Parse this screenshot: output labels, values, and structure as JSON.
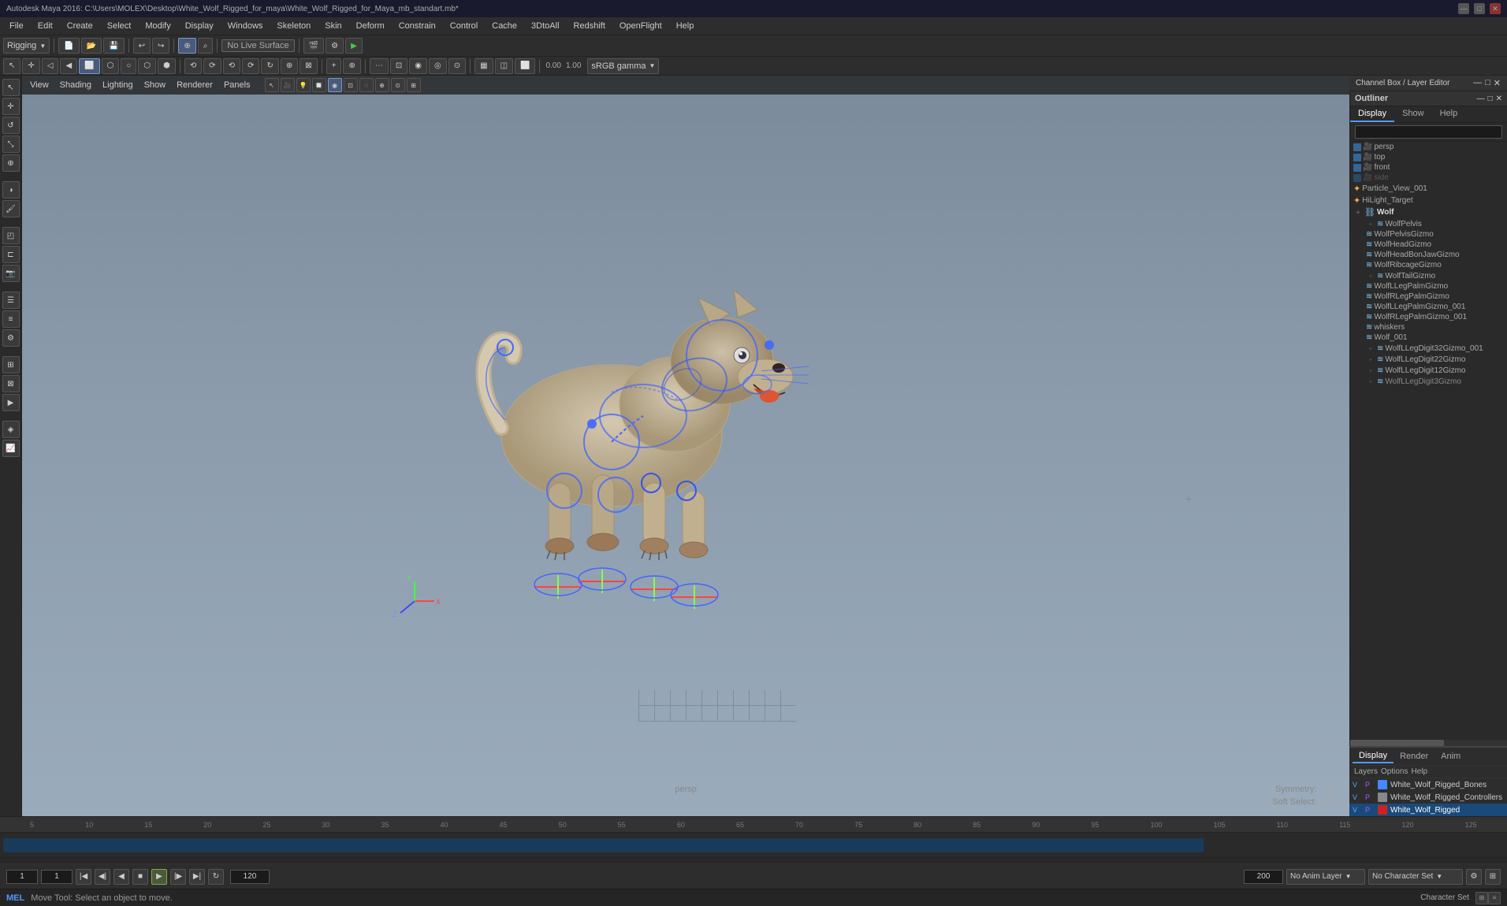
{
  "titlebar": {
    "title": "Autodesk Maya 2016: C:\\Users\\MOLEX\\Desktop\\White_Wolf_Rigged_for_maya\\White_Wolf_Rigged_for_Maya_mb_standart.mb*",
    "minimize": "—",
    "maximize": "□",
    "close": "✕"
  },
  "menubar": {
    "items": [
      "File",
      "Edit",
      "Create",
      "Select",
      "Modify",
      "Display",
      "Windows",
      "Skeleton",
      "Skin",
      "Deform",
      "Constrain",
      "Control",
      "Cache",
      "3DtoAll",
      "Redshift",
      "OpenFlight",
      "Help"
    ]
  },
  "toolbar1": {
    "mode_dropdown": "Rigging",
    "no_live_surface": "No Live Surface"
  },
  "viewport": {
    "menu_items": [
      "View",
      "Shading",
      "Lighting",
      "Show",
      "Renderer",
      "Panels"
    ],
    "persp_label": "persp",
    "symmetry_label": "Symmetry:",
    "symmetry_value": "Off",
    "soft_select_label": "Soft Select:",
    "soft_select_value": "Off",
    "gamma_label": "sRGB gamma",
    "val1": "0.00",
    "val2": "1.00"
  },
  "outliner": {
    "title": "Outliner",
    "tabs": [
      "Display",
      "Show",
      "Help"
    ],
    "items": [
      {
        "indent": 0,
        "icon": "cam",
        "expand": "",
        "label": "persp",
        "color": "#336699"
      },
      {
        "indent": 0,
        "icon": "cam",
        "expand": "",
        "label": "top",
        "color": "#336699"
      },
      {
        "indent": 0,
        "icon": "cam",
        "expand": "",
        "label": "front",
        "color": "#336699"
      },
      {
        "indent": 0,
        "icon": "cam",
        "expand": "",
        "label": "side",
        "color": "#336699"
      },
      {
        "indent": 0,
        "icon": "star",
        "expand": "",
        "label": "Particle_View_001",
        "color": ""
      },
      {
        "indent": 0,
        "icon": "star",
        "expand": "",
        "label": "HiLight_Target",
        "color": ""
      },
      {
        "indent": 0,
        "icon": "chain",
        "expand": "+",
        "label": "Wolf",
        "color": ""
      },
      {
        "indent": 1,
        "icon": "chain",
        "expand": "",
        "label": "WolfPelvis",
        "color": ""
      },
      {
        "indent": 1,
        "icon": "chain",
        "expand": "",
        "label": "WolfPelvisGizmo",
        "color": ""
      },
      {
        "indent": 1,
        "icon": "chain",
        "expand": "",
        "label": "WolfHeadGizmo",
        "color": ""
      },
      {
        "indent": 1,
        "icon": "chain",
        "expand": "",
        "label": "WolfHeadBonJawGizmo",
        "color": ""
      },
      {
        "indent": 1,
        "icon": "chain",
        "expand": "",
        "label": "WolfRibcageGizmo",
        "color": ""
      },
      {
        "indent": 1,
        "icon": "chain",
        "expand": "+",
        "label": "WolfTailGizmo",
        "color": ""
      },
      {
        "indent": 1,
        "icon": "chain",
        "expand": "",
        "label": "WolfLLegPalmGizmo",
        "color": ""
      },
      {
        "indent": 1,
        "icon": "chain",
        "expand": "",
        "label": "WolfRLegPalmGizmo",
        "color": ""
      },
      {
        "indent": 1,
        "icon": "chain",
        "expand": "",
        "label": "WolfLLegPalmGizmo_001",
        "color": ""
      },
      {
        "indent": 1,
        "icon": "chain",
        "expand": "",
        "label": "WolfRLegPalmGizmo_001",
        "color": ""
      },
      {
        "indent": 1,
        "icon": "chain",
        "expand": "",
        "label": "whiskers",
        "color": ""
      },
      {
        "indent": 1,
        "icon": "chain",
        "expand": "",
        "label": "Wolf_001",
        "color": ""
      },
      {
        "indent": 1,
        "icon": "chain",
        "expand": "+",
        "label": "WolfLLegDigit32Gizmo_001",
        "color": ""
      },
      {
        "indent": 1,
        "icon": "chain",
        "expand": "+",
        "label": "WolfLLegDigit22Gizmo",
        "color": ""
      },
      {
        "indent": 1,
        "icon": "chain",
        "expand": "+",
        "label": "WolfLLegDigit12Gizmo",
        "color": ""
      },
      {
        "indent": 1,
        "icon": "chain",
        "expand": "+",
        "label": "WolfLLegDigit3Gizmo",
        "color": ""
      }
    ]
  },
  "layer_panel": {
    "tabs": [
      "Display",
      "Render",
      "Anim"
    ],
    "options": [
      "Layers",
      "Options",
      "Help"
    ],
    "layers": [
      {
        "v": "V",
        "p": "P",
        "color": "#4488ff",
        "name": "White_Wolf_Rigged_Bones",
        "highlighted": false
      },
      {
        "v": "V",
        "p": "P",
        "color": "#888888",
        "name": "White_Wolf_Rigged_Controllers",
        "highlighted": false
      },
      {
        "v": "V",
        "p": "P",
        "color": "#cc2222",
        "name": "White_Wolf_Rigged",
        "highlighted": true
      }
    ]
  },
  "channelbox": {
    "header": "Channel Box / Layer Editor",
    "tabs": [
      "Display",
      "Render",
      "Anim"
    ]
  },
  "timeline": {
    "start_frame": "1",
    "current_frame": "1",
    "end_frame": "120",
    "range_start": "1",
    "range_end": "200",
    "ticks": [
      "5",
      "10",
      "15",
      "20",
      "25",
      "30",
      "35",
      "40",
      "45",
      "50",
      "55",
      "60",
      "65",
      "70",
      "75",
      "80",
      "85",
      "90",
      "95",
      "100",
      "105",
      "110",
      "115",
      "120",
      "125"
    ],
    "no_anim_layer": "No Anim Layer",
    "no_char_set": "No Character Set"
  },
  "statusbar": {
    "mode": "MEL",
    "message": "Move Tool: Select an object to move.",
    "char_set_label": "Character Set"
  },
  "transport": {
    "buttons": [
      "⏮",
      "⏭",
      "◀◀",
      "◀",
      "■",
      "▶",
      "▶▶",
      "⏭",
      "⏮"
    ]
  }
}
